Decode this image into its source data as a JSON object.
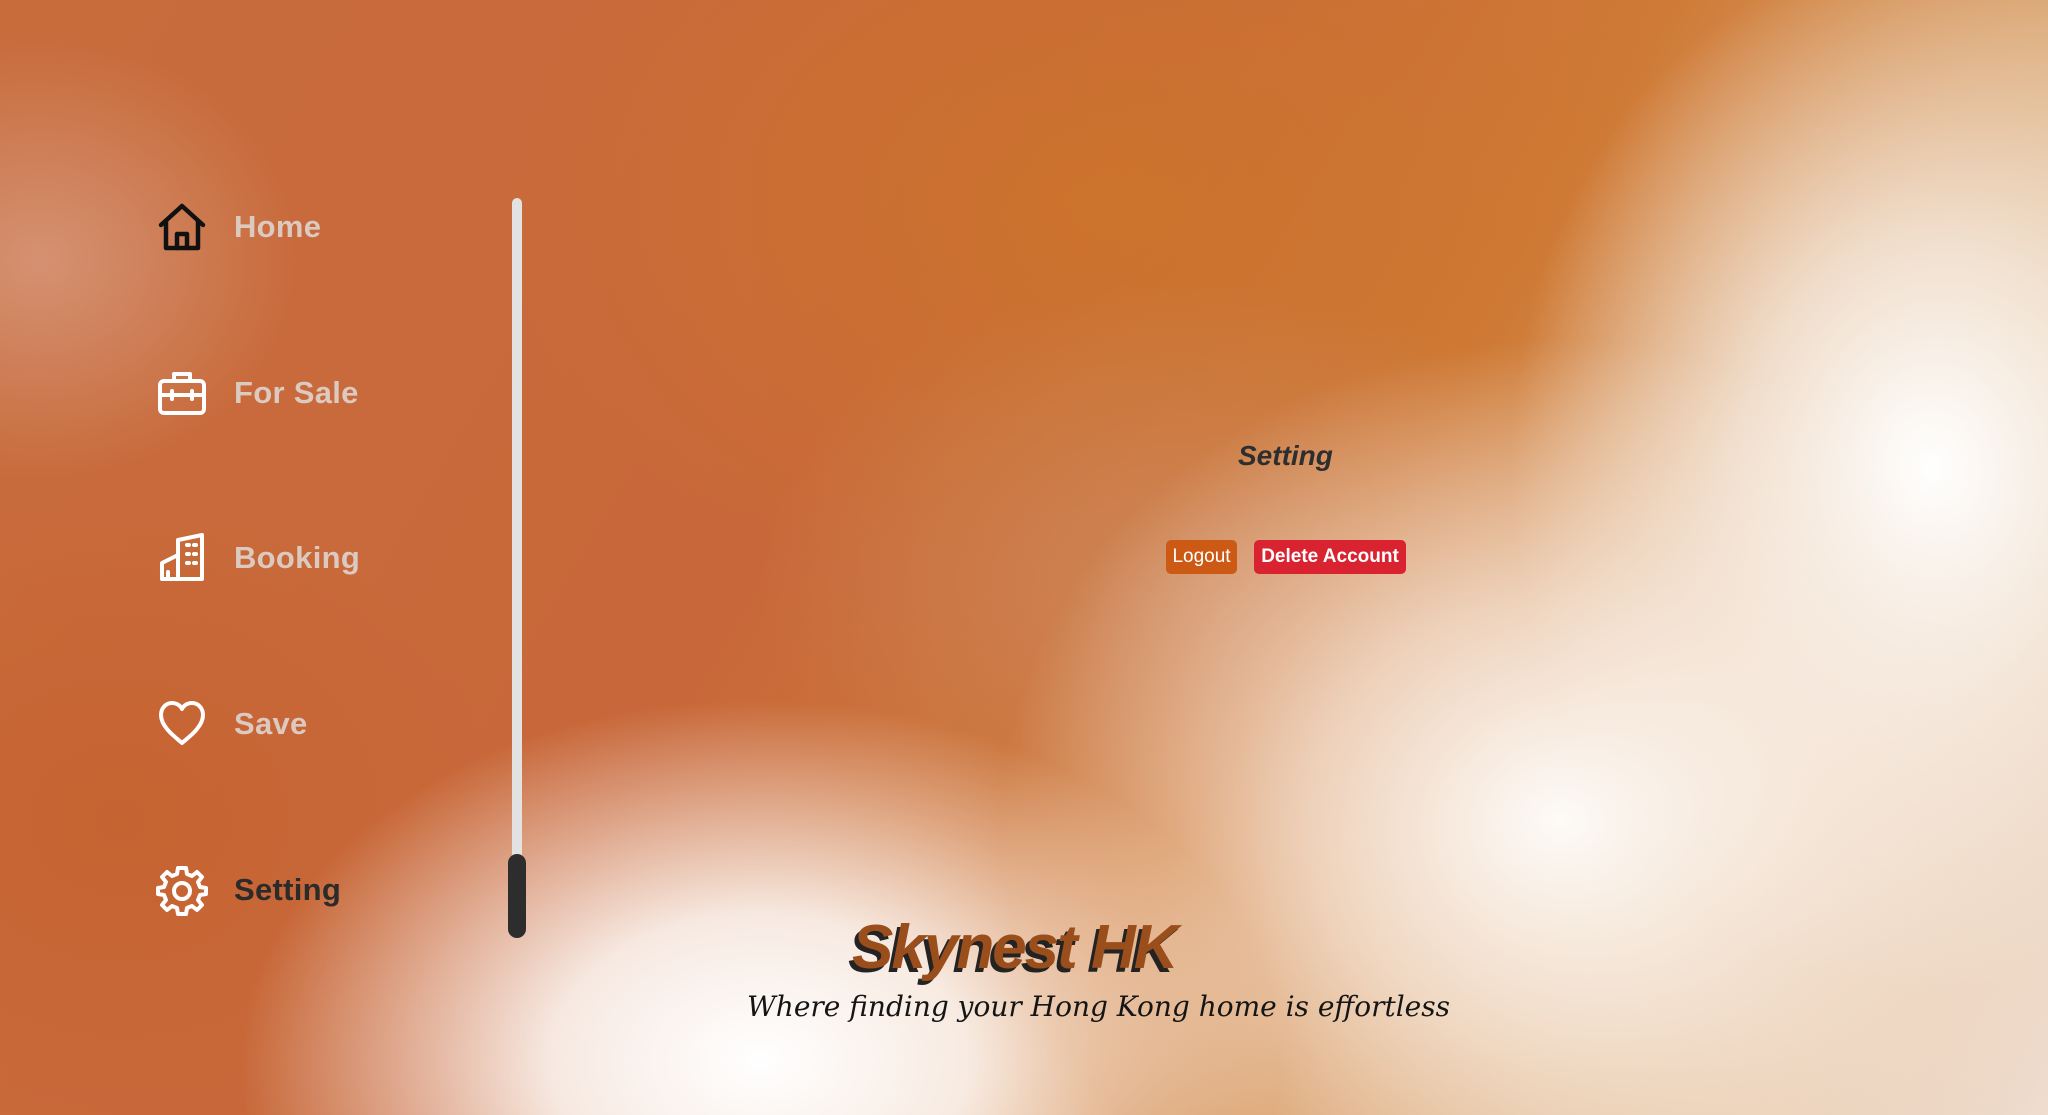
{
  "sidebar": {
    "items": [
      {
        "label": "Home",
        "icon": "home-icon",
        "active": false
      },
      {
        "label": "For Sale",
        "icon": "briefcase-icon",
        "active": false
      },
      {
        "label": "Booking",
        "icon": "building-icon",
        "active": false
      },
      {
        "label": "Save",
        "icon": "heart-icon",
        "active": false
      },
      {
        "label": "Setting",
        "icon": "gear-icon",
        "active": true
      }
    ]
  },
  "main": {
    "title": "Setting",
    "logout_label": "Logout",
    "delete_label": "Delete Account"
  },
  "brand": {
    "name": "Skynest HK",
    "tagline": "Where finding your Hong Kong home is effortless"
  },
  "colors": {
    "logout_button": "#cc5a14",
    "delete_button": "#da2330",
    "brand_text": "#9a4e1c",
    "nav_inactive": "#dcc9c0",
    "nav_active": "#2b2b2b"
  }
}
